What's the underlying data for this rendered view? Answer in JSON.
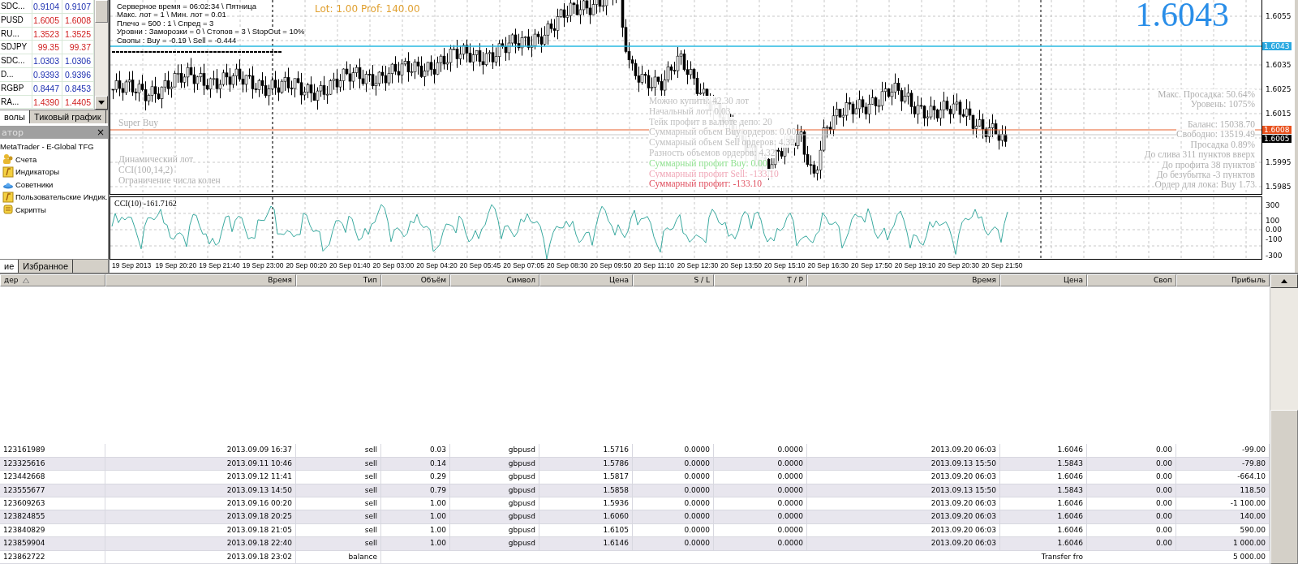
{
  "market_watch": {
    "rows": [
      {
        "symbol": "SDC...",
        "bid": "0.9104",
        "ask": "0.9107",
        "kind": "up"
      },
      {
        "symbol": "PUSD",
        "bid": "1.6005",
        "ask": "1.6008",
        "kind": "down"
      },
      {
        "symbol": "RU...",
        "bid": "1.3523",
        "ask": "1.3525",
        "kind": "down"
      },
      {
        "symbol": "SDJPY",
        "bid": "99.35",
        "ask": "99.37",
        "kind": "down"
      },
      {
        "symbol": "SDC...",
        "bid": "1.0303",
        "ask": "1.0306",
        "kind": "up"
      },
      {
        "symbol": "D...",
        "bid": "0.9393",
        "ask": "0.9396",
        "kind": "up"
      },
      {
        "symbol": "RGBP",
        "bid": "0.8447",
        "ask": "0.8453",
        "kind": "up"
      },
      {
        "symbol": "RA...",
        "bid": "1.4390",
        "ask": "1.4405",
        "kind": "down"
      }
    ]
  },
  "left_tabs": [
    {
      "label": "волы",
      "selected": true
    },
    {
      "label": "Тиковый график",
      "selected": false
    }
  ],
  "navigator": {
    "title": "атор",
    "close": "×",
    "root": {
      "label": "MetaTrader - E-Global TFG",
      "children": [
        {
          "label": "Счета",
          "kind": "accounts"
        },
        {
          "label": "Индикаторы",
          "kind": "indicators"
        },
        {
          "label": "Советники",
          "kind": "experts"
        },
        {
          "label": "Пользовательские Индик.",
          "kind": "indicators"
        },
        {
          "label": "Скрипты",
          "kind": "scripts"
        }
      ]
    }
  },
  "bottom_tabs": [
    {
      "label": "ие",
      "selected": true
    },
    {
      "label": "Избранное",
      "selected": false
    }
  ],
  "chart": {
    "info_lines": [
      "Серверное время = 06:02:34 \\ Пятница",
      "Макс. лот = 1 \\ Мин. лот = 0.01",
      "Плечо = 500 : 1 \\ Спред = 3",
      "Уровни : Заморозки = 0 \\ Стопов = 3 \\ StopOut = 10%",
      "Свопы : Buy = -0.19 \\ Sell = -0.444"
    ],
    "lot_text": "Lot: 1.00 Prof: 140.00",
    "price": "1.6043",
    "signal": "Super Buy",
    "settings": [
      "Динамический лот",
      "CCI(100,14,2)",
      "Ограничение числа колен"
    ],
    "stats": [
      {
        "text": "Можно купить: 42.30 лот",
        "kind": "plain"
      },
      {
        "text": "Начальный лот: 0.03",
        "kind": "plain"
      },
      {
        "text": "Тейк профит в валюте депо: 20",
        "kind": "plain"
      },
      {
        "text": "Суммарный объем Buy ордеров: 0.00",
        "kind": "plain"
      },
      {
        "text": "Суммарный объем Sell ордеров: 4.32",
        "kind": "plain"
      },
      {
        "text": "Разность объемов ордеров: 4.32",
        "kind": "plain"
      },
      {
        "text": "Суммарный профит Buy: 0.00",
        "kind": "buy"
      },
      {
        "text": "Суммарный профит Sell: -133.10",
        "kind": "sell"
      },
      {
        "text": "Суммарный профит: -133.10",
        "kind": "total"
      }
    ],
    "account_top": [
      "Макс. Просадка: 50.64%",
      "Уровень: 1075%"
    ],
    "account": [
      "Баланс: 15038.70",
      "Свободно: 13519.49",
      "Просадка 0.89%",
      "До слива 311 пунктов вверх",
      "До профита 38 пунктов",
      "До безубытка -3 пунктов",
      "Ордер для лока: Buy 1.73"
    ],
    "price_ticks": [
      "1.6055",
      "1.6035",
      "1.6025",
      "1.6015",
      "1.5995",
      "1.5985"
    ],
    "price_tags": [
      {
        "label": "1.6043",
        "kind": "ask"
      },
      {
        "label": "1.6008",
        "kind": "line"
      },
      {
        "label": "1.6005",
        "kind": "bid"
      }
    ],
    "indicator": {
      "title": "CCI(10) -161.7162",
      "ticks": [
        "300",
        "100",
        "0.00",
        "-100",
        "-300"
      ]
    },
    "time_axis": [
      "19 Sep 2013",
      "19 Sep 20:20",
      "19 Sep 21:40",
      "19 Sep 23:00",
      "20 Sep 00:20",
      "20 Sep 01:40",
      "20 Sep 03:00",
      "20 Sep 04:20",
      "20 Sep 05:45",
      "20 Sep 07:05",
      "20 Sep 08:30",
      "20 Sep 09:50",
      "20 Sep 11:10",
      "20 Sep 12:30",
      "20 Sep 13:50",
      "20 Sep 15:10",
      "20 Sep 16:30",
      "20 Sep 17:50",
      "20 Sep 19:10",
      "20 Sep 20:30",
      "20 Sep 21:50"
    ]
  },
  "orders": {
    "columns": [
      "дер",
      "Время",
      "Тип",
      "Объём",
      "Символ",
      "Цена",
      "S / L",
      "T / P",
      "Время",
      "Цена",
      "Своп",
      "Прибыль"
    ],
    "rows": [
      {
        "kind": "trade",
        "cells": [
          "123161989",
          "2013.09.09 16:37",
          "sell",
          "0.03",
          "gbpusd",
          "1.5716",
          "0.0000",
          "0.0000",
          "2013.09.20 06:03",
          "1.6046",
          "0.00",
          "-99.00"
        ]
      },
      {
        "kind": "trade",
        "cells": [
          "123325616",
          "2013.09.11 10:46",
          "sell",
          "0.14",
          "gbpusd",
          "1.5786",
          "0.0000",
          "0.0000",
          "2013.09.13 15:50",
          "1.5843",
          "0.00",
          "-79.80"
        ]
      },
      {
        "kind": "trade",
        "cells": [
          "123442668",
          "2013.09.12 11:41",
          "sell",
          "0.29",
          "gbpusd",
          "1.5817",
          "0.0000",
          "0.0000",
          "2013.09.20 06:03",
          "1.6046",
          "0.00",
          "-664.10"
        ]
      },
      {
        "kind": "trade",
        "cells": [
          "123555677",
          "2013.09.13 14:50",
          "sell",
          "0.79",
          "gbpusd",
          "1.5858",
          "0.0000",
          "0.0000",
          "2013.09.13 15:50",
          "1.5843",
          "0.00",
          "118.50"
        ]
      },
      {
        "kind": "trade",
        "cells": [
          "123609263",
          "2013.09.16 00:20",
          "sell",
          "1.00",
          "gbpusd",
          "1.5936",
          "0.0000",
          "0.0000",
          "2013.09.20 06:03",
          "1.6046",
          "0.00",
          "-1 100.00"
        ]
      },
      {
        "kind": "trade",
        "cells": [
          "123824855",
          "2013.09.18 20:25",
          "sell",
          "1.00",
          "gbpusd",
          "1.6060",
          "0.0000",
          "0.0000",
          "2013.09.20 06:03",
          "1.6046",
          "0.00",
          "140.00"
        ]
      },
      {
        "kind": "trade",
        "cells": [
          "123840829",
          "2013.09.18 21:05",
          "sell",
          "1.00",
          "gbpusd",
          "1.6105",
          "0.0000",
          "0.0000",
          "2013.09.20 06:03",
          "1.6046",
          "0.00",
          "590.00"
        ]
      },
      {
        "kind": "trade",
        "cells": [
          "123859904",
          "2013.09.18 22:40",
          "sell",
          "1.00",
          "gbpusd",
          "1.6146",
          "0.0000",
          "0.0000",
          "2013.09.20 06:03",
          "1.6046",
          "0.00",
          "1 000.00"
        ]
      },
      {
        "kind": "balance",
        "cells": [
          "123862722",
          "2013.09.18 23:02",
          "balance",
          "",
          "",
          "",
          "",
          "",
          "",
          "Transfer fro",
          "",
          "5 000.00"
        ]
      }
    ]
  }
}
